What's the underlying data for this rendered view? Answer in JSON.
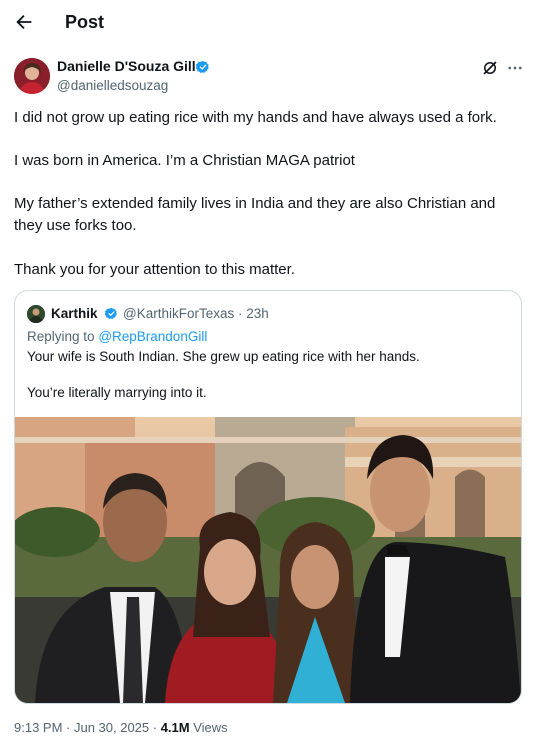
{
  "header": {
    "title": "Post"
  },
  "author": {
    "name": "Danielle D'Souza Gill",
    "handle": "@danielledsouzag",
    "verified_color": "#1d9bf0"
  },
  "post": {
    "paragraphs": [
      "I did not grow up eating rice with my hands and have always used a fork.",
      "I was born in America. I’m a Christian MAGA patriot",
      "My father’s extended family lives in India and they are also Christian and they use forks too.",
      "Thank you for your attention to this matter."
    ]
  },
  "quoted": {
    "name": "Karthik",
    "handle_time": "@KarthikForTexas · 23h",
    "replying_prefix": "Replying to",
    "replying_handle": "@RepBrandonGill",
    "text_1": "Your wife is South Indian. She grew up eating rice with her hands.",
    "text_2": "You’re literally marrying into it."
  },
  "footer": {
    "timestamp": "9:13 PM · Jun 30, 2025 · ",
    "views_count": "4.1M",
    "views_label": " Views"
  },
  "icons": {
    "back": "arrow-left-icon",
    "verified": "verified-badge-icon",
    "grok": "grok-icon",
    "more": "more-horizontal-icon"
  }
}
